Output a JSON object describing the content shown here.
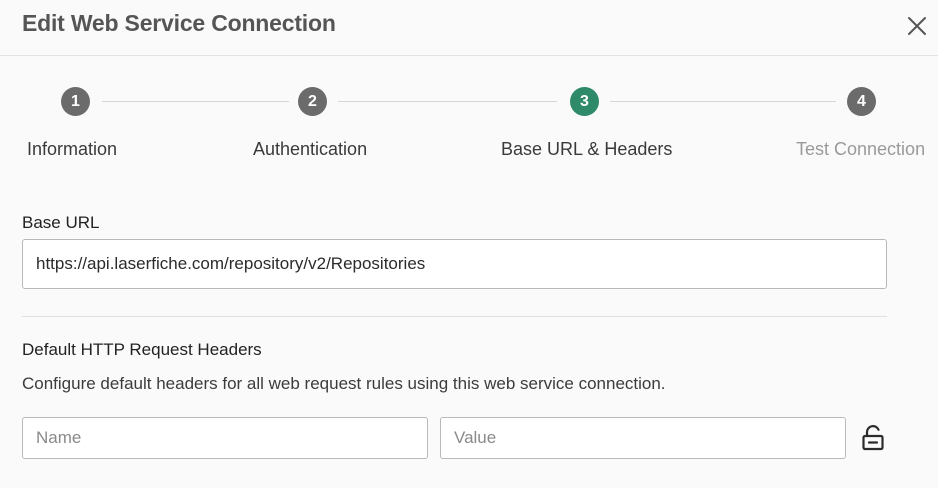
{
  "dialog": {
    "title": "Edit Web Service Connection",
    "close_icon": "close-icon"
  },
  "stepper": {
    "active_index": 2,
    "steps": [
      {
        "number": "1",
        "label": "Information",
        "state": "complete"
      },
      {
        "number": "2",
        "label": "Authentication",
        "state": "complete"
      },
      {
        "number": "3",
        "label": "Base URL & Headers",
        "state": "active"
      },
      {
        "number": "4",
        "label": "Test Connection",
        "state": "disabled"
      }
    ]
  },
  "base_url": {
    "label": "Base URL",
    "value": "https://api.laserfiche.com/repository/v2/Repositories"
  },
  "headers": {
    "title": "Default HTTP Request Headers",
    "description": "Configure default headers for all web request rules using this web service connection.",
    "name_placeholder": "Name",
    "value_placeholder": "Value",
    "lock_icon": "unlock-icon"
  },
  "colors": {
    "active_step": "#2f8a6a",
    "inactive_step": "#6b6b6b",
    "title": "#555555"
  }
}
